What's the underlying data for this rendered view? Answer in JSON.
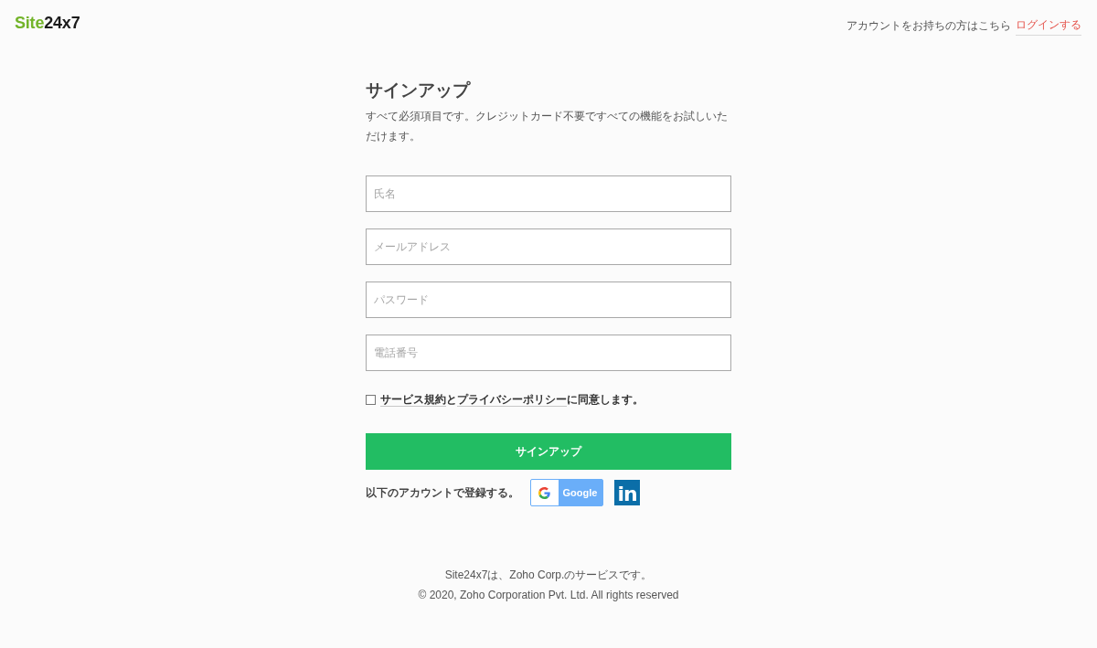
{
  "header": {
    "logo": {
      "brand": "Site",
      "suffix": "24x7"
    },
    "account_prompt": "アカウントをお持ちの方はこちら",
    "login_link": "ログインする"
  },
  "form": {
    "title": "サインアップ",
    "description": "すべて必須項目です。クレジットカード不要ですべての機能をお試しいただけます。",
    "fields": [
      {
        "placeholder": "氏名"
      },
      {
        "placeholder": "メールアドレス"
      },
      {
        "placeholder": "パスワード"
      },
      {
        "placeholder": "電話番号"
      }
    ],
    "consent": {
      "checked": false,
      "parts": [
        {
          "kind": "link",
          "text": "サービス規約"
        },
        {
          "kind": "text",
          "text": "と"
        },
        {
          "kind": "link",
          "text": "プライバシーポリシー"
        },
        {
          "kind": "text",
          "text": "に同意します。"
        }
      ]
    },
    "submit_button": "サインアップ",
    "social": {
      "label": "以下のアカウントで登録する。",
      "providers": [
        {
          "kind": "google",
          "label": "Google"
        },
        {
          "kind": "linkedin",
          "label": "in"
        }
      ]
    }
  },
  "footer": {
    "lines": [
      "Site24x7は、Zoho Corp.のサービスです。",
      "© 2020, Zoho Corporation Pvt. Ltd. All rights reserved"
    ]
  }
}
